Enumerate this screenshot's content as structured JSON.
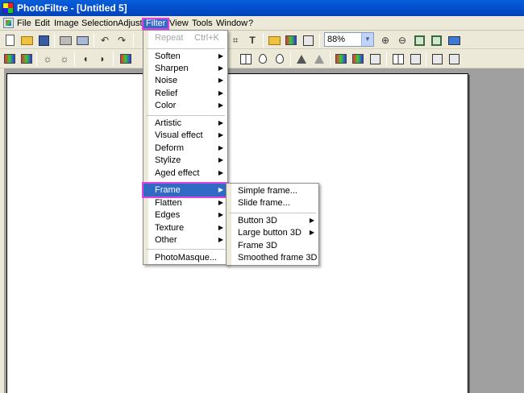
{
  "window": {
    "app_name": "PhotoFiltre",
    "title": "PhotoFiltre - [Untitled 5]"
  },
  "menubar": {
    "items": [
      "File",
      "Edit",
      "Image",
      "Selection",
      "Adjust",
      "Filter",
      "View",
      "Tools",
      "Window",
      "?"
    ],
    "active": "Filter"
  },
  "toolbar": {
    "zoom_value": "88%"
  },
  "filter_menu": {
    "repeat": {
      "label": "Repeat",
      "shortcut": "Ctrl+K",
      "enabled": false
    },
    "group1": [
      "Soften",
      "Sharpen",
      "Noise",
      "Relief",
      "Color"
    ],
    "group2": [
      "Artistic",
      "Visual effect",
      "Deform",
      "Stylize",
      "Aged effect"
    ],
    "group3": [
      "Frame",
      "Flatten",
      "Edges",
      "Texture",
      "Other"
    ],
    "photomasque": "PhotoMasque...",
    "highlighted": "Frame"
  },
  "frame_submenu": {
    "group1": [
      "Simple frame...",
      "Slide frame..."
    ],
    "group2": [
      {
        "label": "Button 3D",
        "has_submenu": true
      },
      {
        "label": "Large button 3D",
        "has_submenu": true
      },
      {
        "label": "Frame 3D",
        "has_submenu": false
      },
      {
        "label": "Smoothed frame 3D",
        "has_submenu": false
      }
    ]
  },
  "icons": {
    "submenu_arrow": "▶",
    "dropdown_arrow": "▼"
  },
  "colors": {
    "titlebar": "#0451d0",
    "highlight": "#316ac5",
    "highlight_outline": "#e040e0"
  }
}
